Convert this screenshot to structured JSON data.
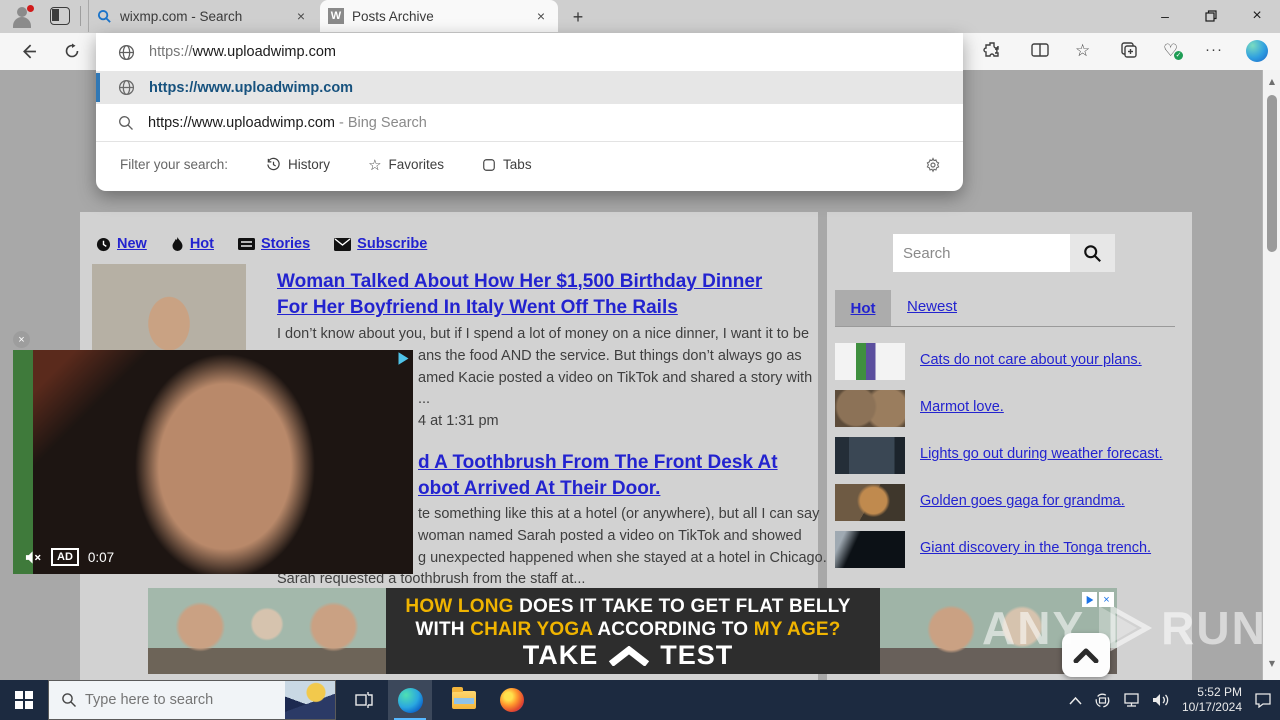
{
  "window": {
    "tabs": [
      {
        "title": "wixmp.com - Search",
        "favicon": "bing-search"
      },
      {
        "title": "Posts Archive",
        "favicon_letter": "W"
      }
    ]
  },
  "omnibox": {
    "typed_scheme": "https://",
    "typed_host": "www.uploadwimp.com",
    "selected_suggestion": "https://www.uploadwimp.com",
    "search_suggestion": "https://www.uploadwimp.com",
    "search_suggestion_suffix": " - Bing Search",
    "filter_label": "Filter your search:",
    "filters": [
      {
        "label": "History"
      },
      {
        "label": "Favorites"
      },
      {
        "label": "Tabs"
      }
    ]
  },
  "site": {
    "nav": [
      {
        "label": "New"
      },
      {
        "label": "Hot"
      },
      {
        "label": "Stories"
      },
      {
        "label": "Subscribe"
      }
    ],
    "article1": {
      "title_line1": "Woman Talked About How Her $1,500 Birthday Dinner",
      "title_line2": "For Her Boyfriend In Italy Went Off The Rails",
      "body_line1": "I don’t know about you, but if I spend a lot of money on a nice dinner, I want it to be",
      "body_line2": "ans the food AND the service. But things don’t always go as",
      "body_line3": "amed Kacie posted a video on TikTok and shared a story with",
      "body_line4": "...",
      "date_fragment": "4 at 1:31 pm"
    },
    "article2": {
      "title_line1": "d A Toothbrush From The Front Desk At",
      "title_line2": "obot Arrived At Their Door.",
      "body_line1": "te something like this at a hotel (or anywhere), but all I can say",
      "body_line2": "woman named Sarah posted a video on TikTok and showed",
      "body_line3": "g unexpected happened when she stayed at a hotel in Chicago.",
      "body_line4": "Sarah requested a toothbrush from the staff at..."
    },
    "sidebar": {
      "search_placeholder": "Search",
      "tabs": [
        {
          "label": "Hot"
        },
        {
          "label": "Newest"
        }
      ],
      "items": [
        {
          "label": "Cats do not care about your plans."
        },
        {
          "label": "Marmot love."
        },
        {
          "label": "Lights go out during weather forecast."
        },
        {
          "label": "Golden goes gaga for grandma."
        },
        {
          "label": "Giant discovery in the Tonga trench."
        }
      ]
    }
  },
  "video_overlay": {
    "ad_badge": "AD",
    "time": "0:07"
  },
  "ad_banner": {
    "line1_highlight": "HOW LONG",
    "line1_rest": " DOES IT TAKE TO GET FLAT BELLY",
    "line2_part1": "WITH ",
    "line2_highlight1": "CHAIR YOGA",
    "line2_part2": " ACCORDING TO ",
    "line2_highlight2": "MY AGE?",
    "cta_left": "TAKE",
    "cta_right": "TEST"
  },
  "watermark": {
    "left": "ANY",
    "right": "RUN"
  },
  "taskbar": {
    "search_placeholder": "Type here to search",
    "clock_time": "5:52 PM",
    "clock_date": "10/17/2024"
  },
  "glyphs": {
    "close": "×",
    "plus": "+",
    "minimize": "–",
    "overflow": "···",
    "star": "☆",
    "heart": "♡",
    "up_caret": "▲",
    "down_caret": "▼"
  },
  "colors": {
    "link_blue": "#2323cf",
    "suggestion_blue": "#17527e",
    "accent_bar_blue": "#3178b5",
    "ad_yellow": "#f0b400",
    "taskbar_bg": "#1c2a40",
    "edge_underline": "#57b8ff"
  }
}
